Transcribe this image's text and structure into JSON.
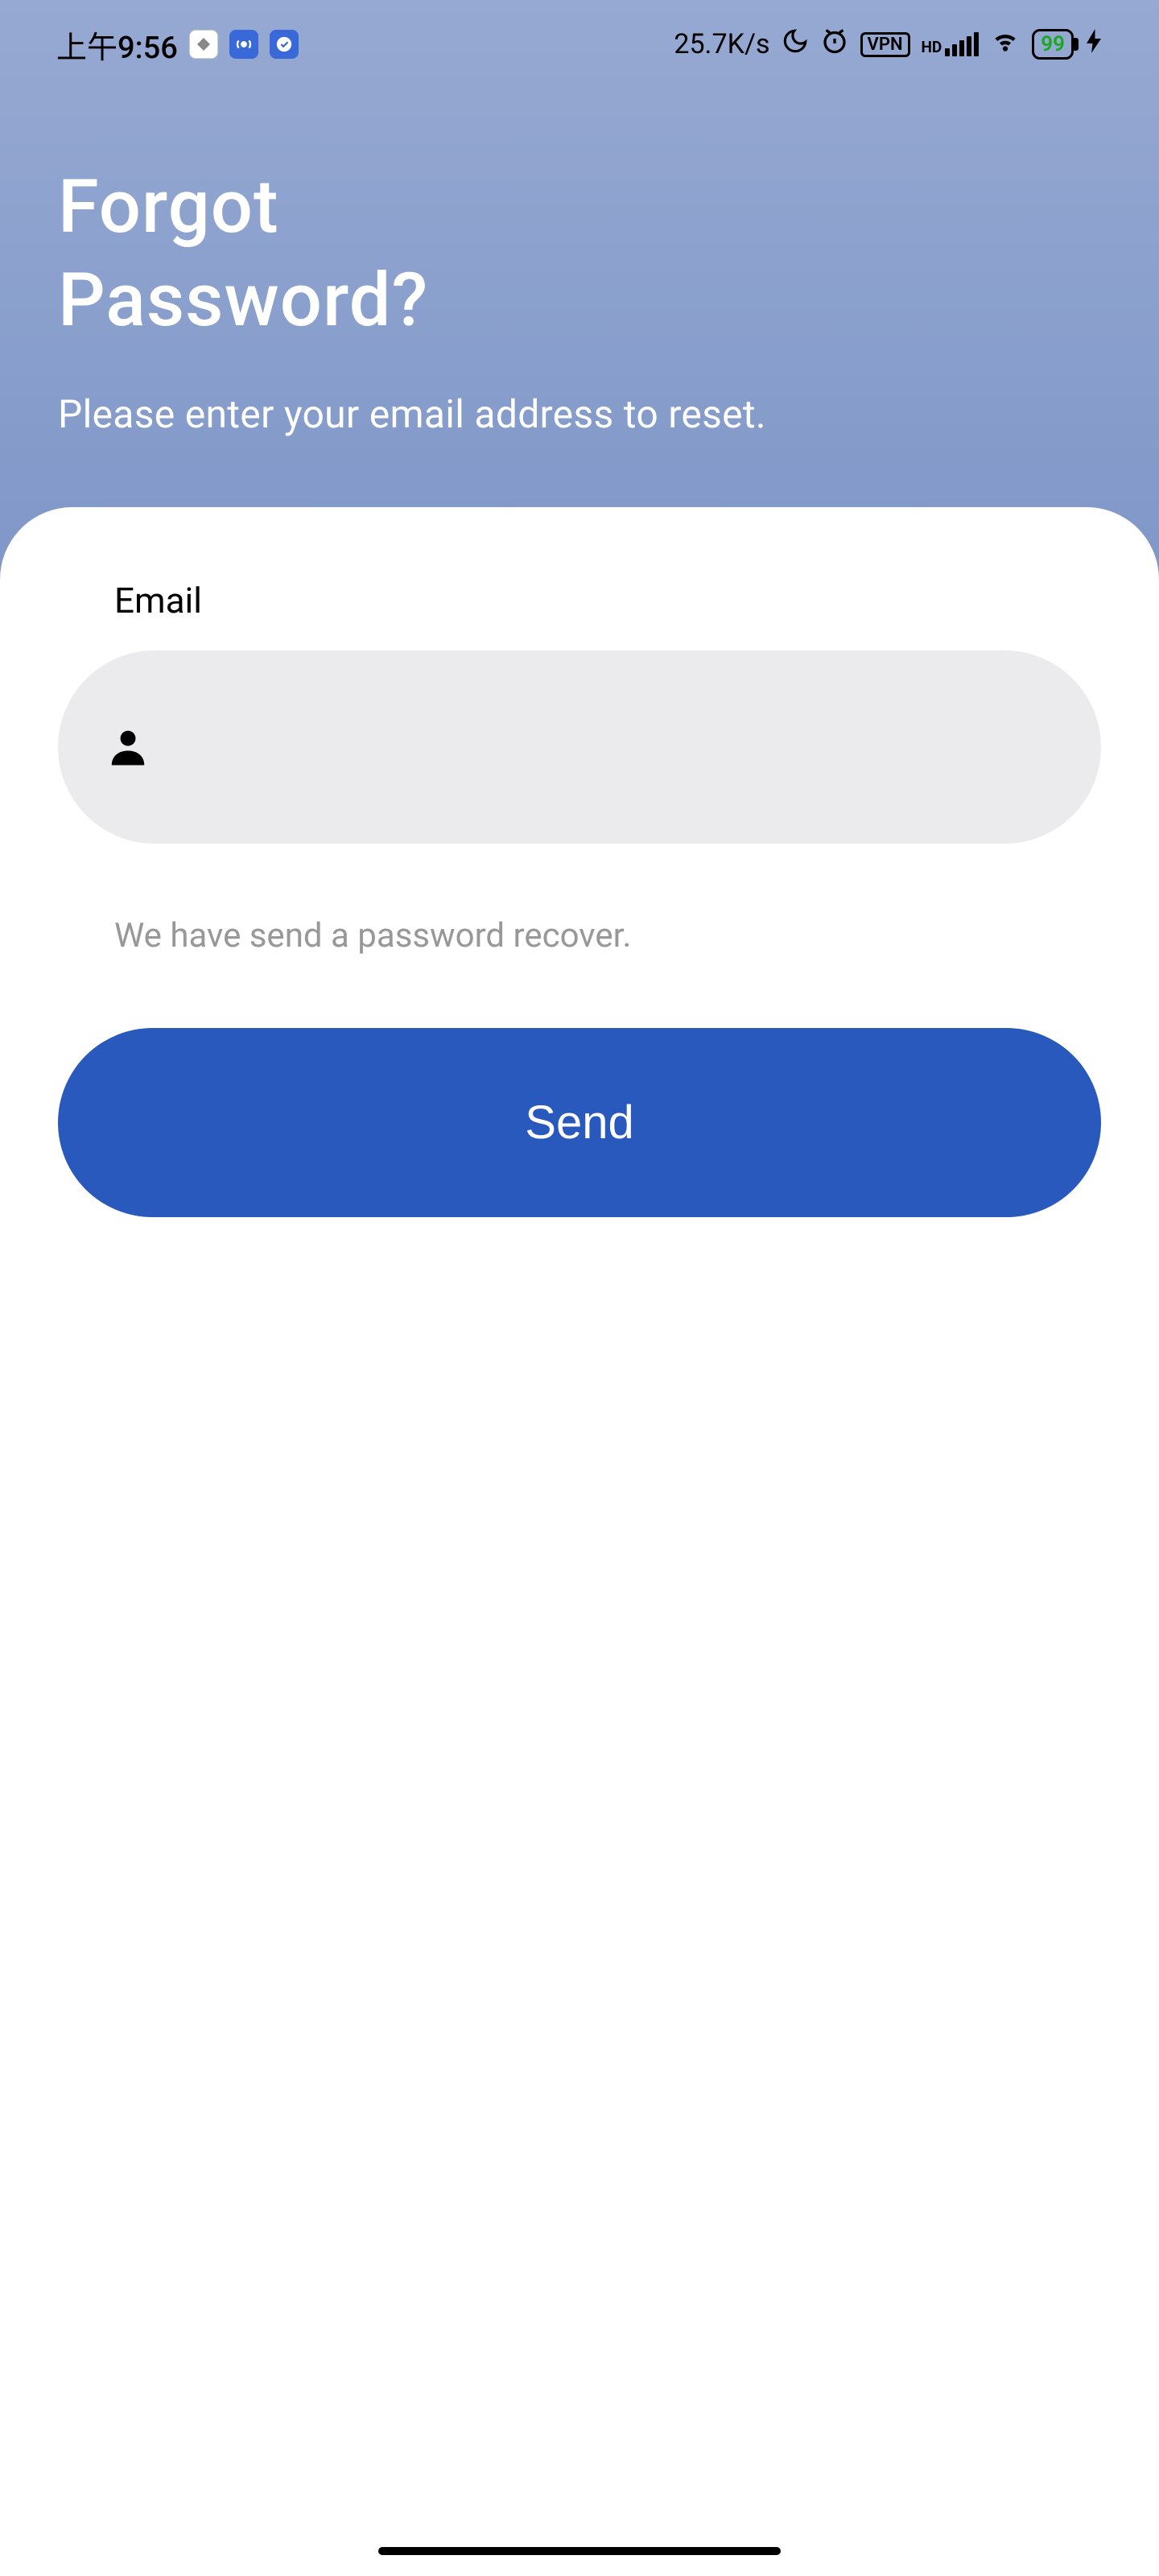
{
  "status": {
    "time": "上午9:56",
    "net_speed": "25.7K/s",
    "vpn": "VPN",
    "hd": "HD",
    "battery": "99"
  },
  "header": {
    "title_line1": "Forgot",
    "title_line2": "Password?",
    "subtitle": "Please enter your email address to reset."
  },
  "form": {
    "email_label": "Email",
    "email_value": "",
    "email_placeholder": "",
    "helper_text": "We have send a password recover.",
    "send_label": "Send"
  }
}
